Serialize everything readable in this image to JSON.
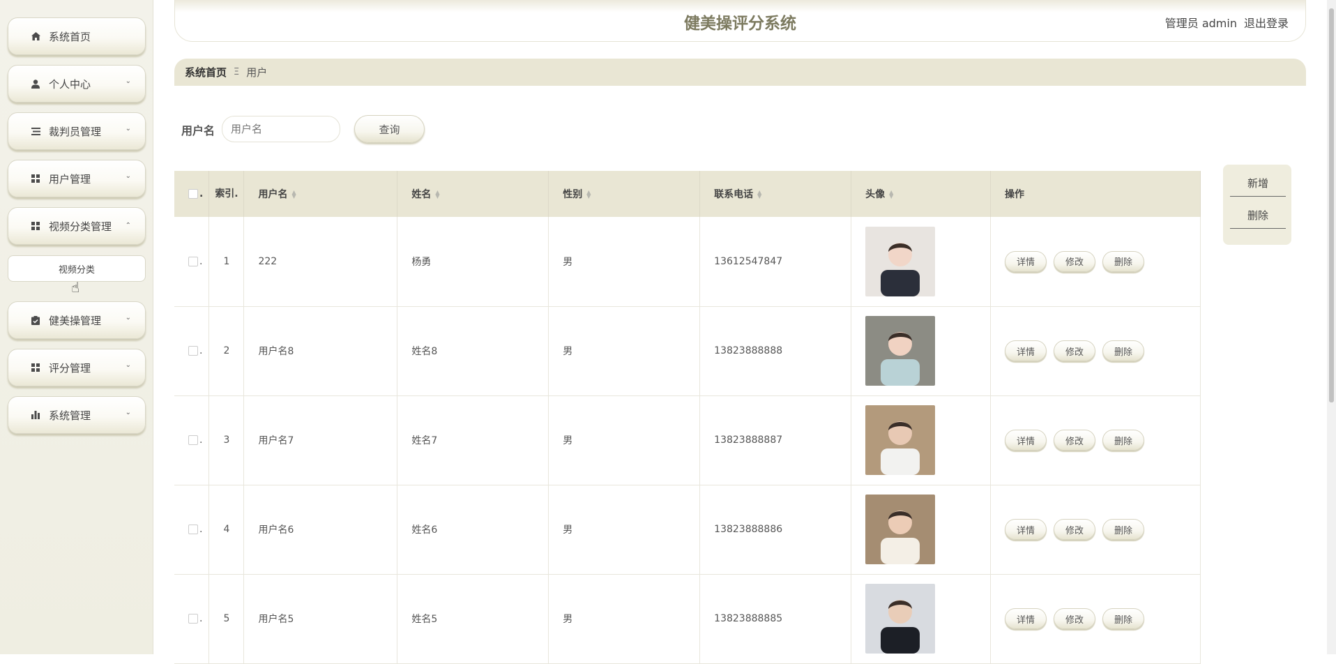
{
  "app": {
    "title": "健美操评分系统",
    "admin_label": "管理员 admin",
    "logout_label": "退出登录"
  },
  "sidebar": {
    "items": [
      {
        "label": "系统首页",
        "icon": "home-icon",
        "expandable": false
      },
      {
        "label": "个人中心",
        "icon": "user-icon",
        "expandable": true
      },
      {
        "label": "裁判员管理",
        "icon": "list-icon",
        "expandable": true
      },
      {
        "label": "用户管理",
        "icon": "grid-icon",
        "expandable": true
      },
      {
        "label": "视频分类管理",
        "icon": "grid-icon",
        "expandable": true,
        "expanded": true
      },
      {
        "label": "健美操管理",
        "icon": "clipboard-icon",
        "expandable": true
      },
      {
        "label": "评分管理",
        "icon": "grid-icon",
        "expandable": true
      },
      {
        "label": "系统管理",
        "icon": "bar-chart-icon",
        "expandable": true
      }
    ],
    "sub_item": "视频分类"
  },
  "breadcrumb": {
    "home": "系统首页",
    "separator": "Ξ",
    "current": "用户"
  },
  "search": {
    "label": "用户名",
    "placeholder": "用户名",
    "button": "查询"
  },
  "actions": {
    "add": "新增",
    "delete": "删除"
  },
  "table": {
    "headers": {
      "index": "索引.",
      "username": "用户名",
      "name": "姓名",
      "gender": "性别",
      "phone": "联系电话",
      "avatar": "头像",
      "ops": "操作"
    },
    "ops": {
      "detail": "详情",
      "edit": "修改",
      "delete": "删除"
    },
    "rows": [
      {
        "index": "1",
        "username": "222",
        "name": "杨勇",
        "gender": "男",
        "phone": "13612547847"
      },
      {
        "index": "2",
        "username": "用户名8",
        "name": "姓名8",
        "gender": "男",
        "phone": "13823888888"
      },
      {
        "index": "3",
        "username": "用户名7",
        "name": "姓名7",
        "gender": "男",
        "phone": "13823888887"
      },
      {
        "index": "4",
        "username": "用户名6",
        "name": "姓名6",
        "gender": "男",
        "phone": "13823888886"
      },
      {
        "index": "5",
        "username": "用户名5",
        "name": "姓名5",
        "gender": "男",
        "phone": "13823888885"
      }
    ]
  },
  "colors": {
    "accent": "#7c7a5f",
    "header_bg": "#e9e6d4",
    "sidebar_bg": "#efeee2"
  }
}
